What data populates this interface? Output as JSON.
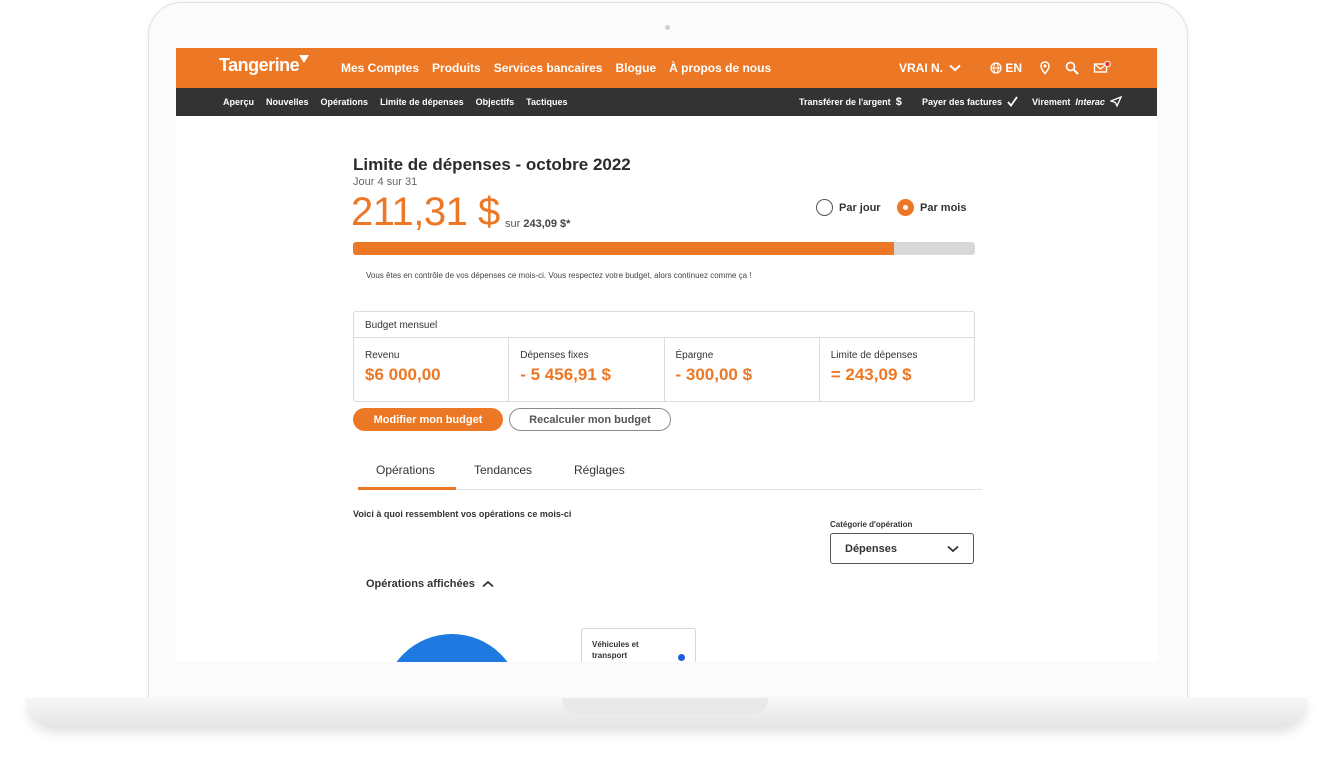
{
  "brand": {
    "name": "Tangerine",
    "accent": "#ec7725",
    "dark_bar": "#333333",
    "chart_blue": "#1e7ae0"
  },
  "main_nav": [
    "Mes Comptes",
    "Produits",
    "Services bancaires",
    "Blogue",
    "À propos de nous"
  ],
  "user": {
    "name": "VRAI N."
  },
  "language": "EN",
  "top_icons": [
    "globe-icon",
    "location-pin-icon",
    "search-icon",
    "mail-icon"
  ],
  "sub_nav": [
    "Aperçu",
    "Nouvelles",
    "Opérations",
    "Limite de dépenses",
    "Objectifs",
    "Tactiques"
  ],
  "quick_actions": {
    "transfer": "Transférer de l'argent",
    "bills": "Payer des factures",
    "interac_prefix": "Virement",
    "interac_brand": "Interac"
  },
  "page": {
    "title": "Limite de dépenses - octobre 2022",
    "day": "Jour 4 sur 31",
    "amount": "211,31 $",
    "of_prefix": "sur",
    "of_total": "243,09 $*",
    "period_options": [
      {
        "label": "Par jour",
        "selected": false
      },
      {
        "label": "Par mois",
        "selected": true
      }
    ],
    "progress_fraction": 0.869,
    "message": "Vous êtes en contrôle de vos dépenses ce mois-ci. Vous respectez votre budget, alors continuez comme ça !"
  },
  "budget": {
    "heading": "Budget mensuel",
    "items": [
      {
        "label": "Revenu",
        "value": "$6 000,00"
      },
      {
        "label": "Dépenses fixes",
        "value": "- 5 456,91 $"
      },
      {
        "label": "Épargne",
        "value": "- 300,00 $"
      },
      {
        "label": "Limite de dépenses",
        "value": "= 243,09 $"
      }
    ],
    "edit_button": "Modifier mon budget",
    "recalc_button": "Recalculer mon budget"
  },
  "tabs": [
    "Opérations",
    "Tendances",
    "Réglages"
  ],
  "active_tab": "Opérations",
  "operations": {
    "intro": "Voici à quoi ressemblent vos opérations ce mois-ci",
    "category_label": "Catégorie d'opération",
    "category_value": "Dépenses",
    "shown_label": "Opérations affichées",
    "legend_item": "Véhicules et transport"
  }
}
